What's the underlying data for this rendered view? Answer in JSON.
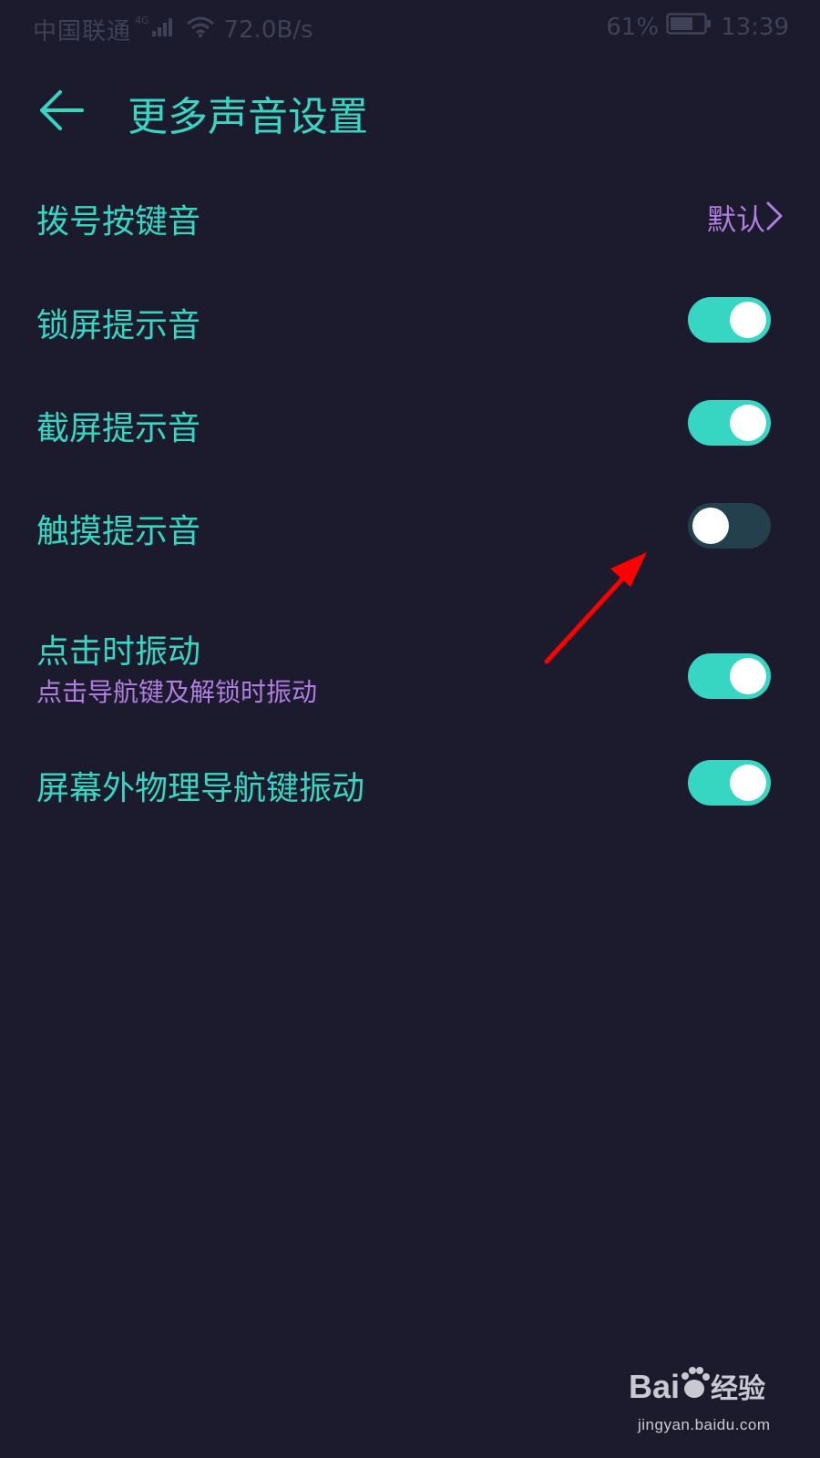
{
  "status_bar": {
    "carrier": "中国联通",
    "network_type": "4G",
    "speed": "72.0B/s",
    "battery_percent": "61%",
    "time": "13:39"
  },
  "header": {
    "title": "更多声音设置"
  },
  "settings": {
    "dial_tone": {
      "label": "拨号按键音",
      "value": "默认"
    },
    "lock_sound": {
      "label": "锁屏提示音",
      "enabled": true
    },
    "screenshot_sound": {
      "label": "截屏提示音",
      "enabled": true
    },
    "touch_sound": {
      "label": "触摸提示音",
      "enabled": false
    },
    "tap_vibrate": {
      "label": "点击时振动",
      "sublabel": "点击导航键及解锁时振动",
      "enabled": true
    },
    "nav_key_vibrate": {
      "label": "屏幕外物理导航键振动",
      "enabled": true
    }
  },
  "colors": {
    "background": "#1b1b2d",
    "accent": "#36d6c3",
    "secondary_text": "#b07de0",
    "toggle_off": "#23404c",
    "annotation": "#ff0000"
  },
  "watermark": {
    "brand": "Bai 经验",
    "url": "jingyan.baidu.com"
  }
}
